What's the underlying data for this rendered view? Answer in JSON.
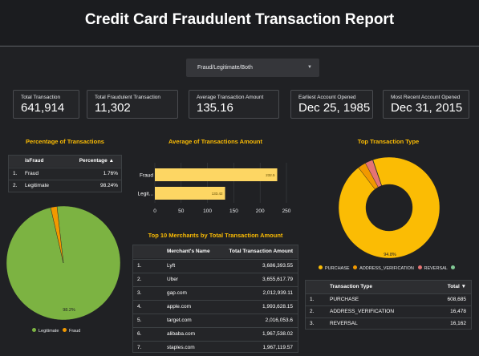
{
  "header": {
    "title": "Credit Card Fraudulent Transaction Report"
  },
  "filter": {
    "label": "Fraud/Legitimate/Both"
  },
  "kpis": [
    {
      "label": "Total Transaction",
      "value": "641,914"
    },
    {
      "label": "Total Fraudulent Transaction",
      "value": "11,302"
    },
    {
      "label": "Average Transaction Amount",
      "value": "135.16"
    },
    {
      "label": "Earliest Account Opened",
      "value": "Dec 25, 1985"
    },
    {
      "label": "Most Recent Account Opened",
      "value": "Dec 31, 2015"
    }
  ],
  "pct_section": {
    "title": "Percentage of Transactions",
    "col_label": "isFraud",
    "col_value": "Percentage",
    "rows": [
      {
        "num": "1.",
        "label": "Fraud",
        "value": "1.76%"
      },
      {
        "num": "2.",
        "label": "Legitimate",
        "value": "98.24%"
      }
    ]
  },
  "avg_section": {
    "title": "Average of Transactions Amount"
  },
  "merchants": {
    "title": "Top 10 Merchants by Total Transaction Amount",
    "col_name": "Merchant's Name",
    "col_amount": "Total Transaction Amount",
    "rows": [
      {
        "num": "1.",
        "name": "Lyft",
        "amount": "3,686,393.55"
      },
      {
        "num": "2.",
        "name": "Uber",
        "amount": "3,655,617.79"
      },
      {
        "num": "3.",
        "name": "gap.com",
        "amount": "2,012,939.11"
      },
      {
        "num": "4.",
        "name": "apple.com",
        "amount": "1,993,628.15"
      },
      {
        "num": "5.",
        "name": "target.com",
        "amount": "2,016,053.6"
      },
      {
        "num": "6.",
        "name": "alibaba.com",
        "amount": "1,967,538.02"
      },
      {
        "num": "7.",
        "name": "staples.com",
        "amount": "1,967,119.57"
      }
    ]
  },
  "type_section": {
    "title": "Top Transaction Type",
    "col_type": "Transaction Type",
    "col_total": "Total",
    "rows": [
      {
        "num": "1.",
        "type": "PURCHASE",
        "total": "608,685"
      },
      {
        "num": "2.",
        "type": "ADDRESS_VERIFICATION",
        "total": "16,478"
      },
      {
        "num": "3.",
        "type": "REVERSAL",
        "total": "16,162"
      }
    ]
  },
  "colors": {
    "accent": "#fbbc04",
    "green": "#7cb342",
    "orange": "#f29900",
    "red": "#e57373",
    "lightgreen": "#81c995",
    "bar": "#fdd663"
  },
  "chart_data": [
    {
      "type": "pie",
      "categories": [
        "Legitimate",
        "Fraud"
      ],
      "values": [
        98.2,
        1.8
      ],
      "labels": [
        "98.2%",
        ""
      ],
      "legend": "bottom"
    },
    {
      "type": "bar",
      "orientation": "horizontal",
      "categories": [
        "Fraud",
        "Legit..."
      ],
      "values": [
        232.5,
        133.42
      ],
      "data_labels": [
        "232.5",
        "133.42"
      ],
      "xlim": [
        0,
        250
      ],
      "xticks": [
        "0",
        "50",
        "100",
        "150",
        "200",
        "250"
      ]
    },
    {
      "type": "pie",
      "donut": true,
      "categories": [
        "PURCHASE",
        "ADDRESS_VERIFICATION",
        "REVERSAL",
        ""
      ],
      "values": [
        94.8,
        2.6,
        2.5,
        0.1
      ],
      "labels": [
        "94.8%",
        "",
        "",
        ""
      ],
      "legend": "bottom"
    }
  ]
}
